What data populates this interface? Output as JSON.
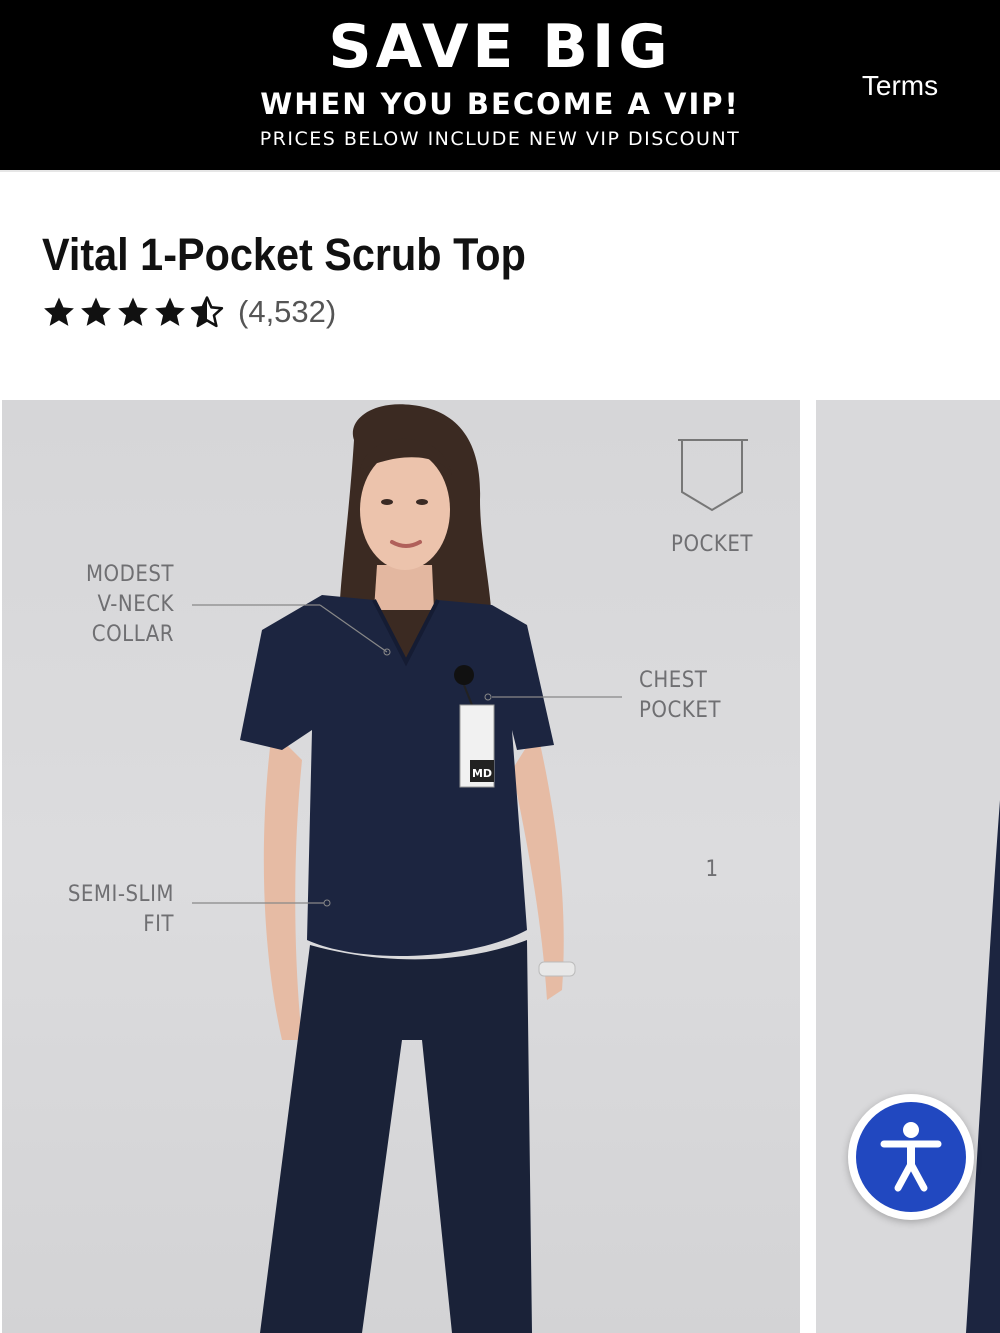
{
  "promo": {
    "headline": "SAVE BIG",
    "subheadline": "WHEN YOU BECOME A VIP!",
    "note": "PRICES BELOW INCLUDE NEW VIP DISCOUNT",
    "terms_label": "Terms"
  },
  "product": {
    "title": "Vital 1-Pocket Scrub Top",
    "rating": 4.5,
    "rating_max": 5,
    "review_count": "(4,532)"
  },
  "gallery": {
    "callouts": {
      "pocket_count": "1",
      "pocket_label": "POCKET",
      "collar_line1": "MODEST",
      "collar_line2": "V-NECK",
      "collar_line3": "COLLAR",
      "chest_line1": "CHEST",
      "chest_line2": "POCKET",
      "fit_line1": "SEMI-SLIM",
      "fit_line2": "FIT"
    },
    "badge_text": "MD"
  },
  "colors": {
    "banner_bg": "#000000",
    "scrub_navy": "#1c2540",
    "accessibility_blue": "#2148c0"
  }
}
